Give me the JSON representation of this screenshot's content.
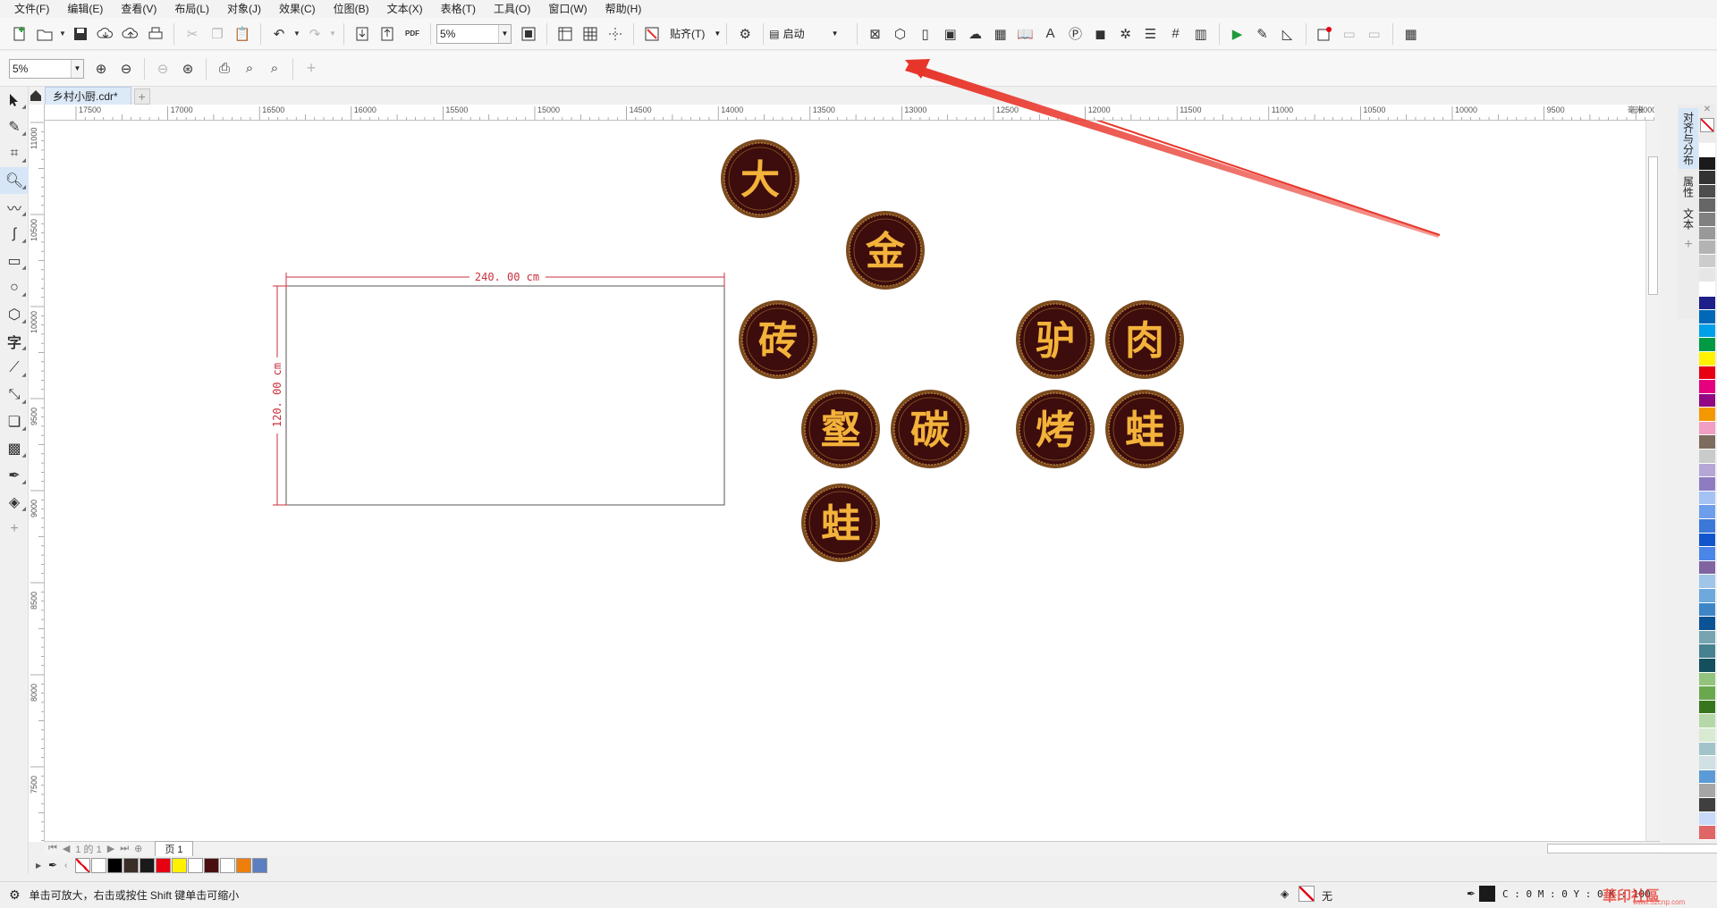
{
  "menu": [
    "文件(F)",
    "编辑(E)",
    "查看(V)",
    "布局(L)",
    "对象(J)",
    "效果(C)",
    "位图(B)",
    "文本(X)",
    "表格(T)",
    "工具(O)",
    "窗口(W)",
    "帮助(H)"
  ],
  "toolbar": {
    "zoom_value": "5%",
    "snap_label": "贴齐(T)",
    "launch_label": "启动",
    "pdf_label": "PDF"
  },
  "propbar": {
    "zoom_value": "5%"
  },
  "document": {
    "tab_label": "乡村小厨.cdr*"
  },
  "ruler": {
    "h_ticks": [
      "17500",
      "17000",
      "16500",
      "16000",
      "15500",
      "15000",
      "14500",
      "14000",
      "13500",
      "13000",
      "12500",
      "12000",
      "11500",
      "11000",
      "10500",
      "10000",
      "9500",
      "9000"
    ],
    "unit": "毫米",
    "v_ticks": [
      "11000",
      "10500",
      "10000",
      "9500",
      "9000",
      "8500",
      "8000",
      "7500"
    ]
  },
  "canvas": {
    "width_dim": "240. 00  cm",
    "height_dim": "120. 00  cm",
    "medals": [
      "大",
      "金",
      "砖",
      "驴",
      "肉",
      "壑",
      "碳",
      "烤",
      "蛙",
      "蛙"
    ]
  },
  "dockers": [
    "对齐与分布",
    "属性",
    "文本"
  ],
  "bottom": {
    "page_nav": "1 的 1",
    "page_tab": "页 1"
  },
  "status": {
    "message": "单击可放大，右击或按住 Shift 键单击可缩小",
    "fill_label": "无",
    "outline_label": "C : 0 M : 0 Y : 0 K : 100",
    "watermark": "華印社區",
    "watermark_url": "www.52cnp.com"
  },
  "colors": {
    "accent_red": "#e8352a",
    "medal_bg": "#3d0c0c",
    "medal_ring": "#7a4a1e",
    "medal_text": "#f3b23a",
    "dim_line": "#c8303c",
    "tab_blue": "#dce9f7"
  },
  "palette_bottom": [
    "#ffffff",
    "#000000",
    "#3a2e2a",
    "#1a1a1a",
    "#e60012",
    "#fff100",
    "#ffffff",
    "#4a1010",
    "#ffffff",
    "#ee7f0d",
    "#5b7fc0"
  ],
  "palette_right": [
    "#ffffff",
    "#1a1a1a",
    "#333333",
    "#4d4d4d",
    "#666666",
    "#808080",
    "#999999",
    "#b3b3b3",
    "#cccccc",
    "#e6e6e6",
    "#ffffff",
    "#1d2088",
    "#0068b7",
    "#00a0e9",
    "#009944",
    "#fff100",
    "#e60012",
    "#e4007f",
    "#920783",
    "#f39800",
    "#f19ec2",
    "#7d6b5d",
    "#c9caca",
    "#b4a7d6",
    "#8e7cc3",
    "#a4c2f4",
    "#6d9eeb",
    "#3c78d8",
    "#1155cc",
    "#4a86e8",
    "#8064a2",
    "#9fc5e8",
    "#6fa8dc",
    "#3d85c6",
    "#0b5394",
    "#76a5af",
    "#45818e",
    "#134f5c",
    "#93c47d",
    "#6aa84f",
    "#38761d",
    "#b6d7a8",
    "#d9ead3",
    "#a2c4c9",
    "#d0e0e3",
    "#5b9bd5",
    "#a6a6a6",
    "#3f3f3f",
    "#c9daf8",
    "#e06666"
  ],
  "icons": [
    "new-doc",
    "open",
    "save",
    "cloud-import",
    "cloud-export",
    "print",
    "undo",
    "redo",
    "import",
    "export",
    "pdf",
    "zoom-fit",
    "settings",
    "arrow-pointer",
    "crop",
    "zoom",
    "freehand",
    "rectangle",
    "ellipse",
    "polygon",
    "text",
    "parallel-dimension",
    "connector",
    "shadow",
    "transparency",
    "eyedropper",
    "interactive-fill"
  ]
}
